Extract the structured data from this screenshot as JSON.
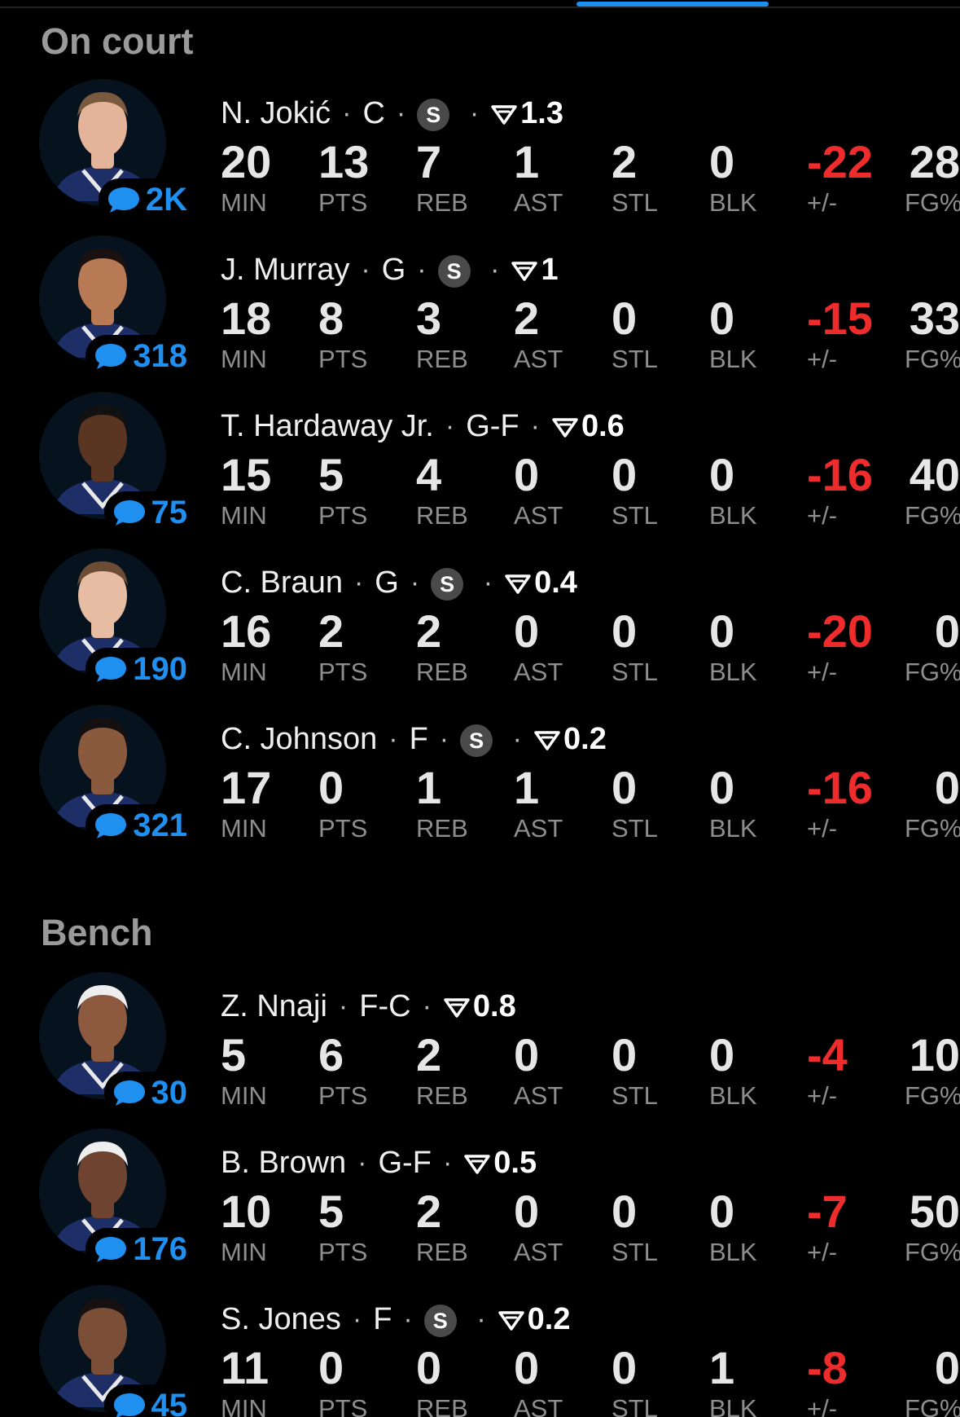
{
  "colors": {
    "accent": "#1f8ff0",
    "negative": "#ee2c2c",
    "muted_label": "#8e8e8e"
  },
  "sections": {
    "on_court": "On court",
    "bench": "Bench"
  },
  "labels": {
    "min": "MIN",
    "pts": "PTS",
    "reb": "REB",
    "ast": "AST",
    "stl": "STL",
    "blk": "BLK",
    "pm": "+/-",
    "fg": "FG%"
  },
  "icons": {
    "comment": "chat-bubble-icon",
    "rating": "rating-chevron-icon",
    "starter": "starter-badge-icon"
  },
  "players": [
    {
      "name": "N. Jokić",
      "pos": "C",
      "starter": "S",
      "rating": "1.3",
      "comments": "2K",
      "min": "20",
      "pts": "13",
      "reb": "7",
      "ast": "1",
      "stl": "2",
      "blk": "0",
      "pm": "-22",
      "fg": "28"
    },
    {
      "name": "J. Murray",
      "pos": "G",
      "starter": "S",
      "rating": "1",
      "comments": "318",
      "min": "18",
      "pts": "8",
      "reb": "3",
      "ast": "2",
      "stl": "0",
      "blk": "0",
      "pm": "-15",
      "fg": "33"
    },
    {
      "name": "T. Hardaway Jr.",
      "pos": "G-F",
      "starter": "",
      "rating": "0.6",
      "comments": "75",
      "min": "15",
      "pts": "5",
      "reb": "4",
      "ast": "0",
      "stl": "0",
      "blk": "0",
      "pm": "-16",
      "fg": "40"
    },
    {
      "name": "C. Braun",
      "pos": "G",
      "starter": "S",
      "rating": "0.4",
      "comments": "190",
      "min": "16",
      "pts": "2",
      "reb": "2",
      "ast": "0",
      "stl": "0",
      "blk": "0",
      "pm": "-20",
      "fg": "0"
    },
    {
      "name": "C. Johnson",
      "pos": "F",
      "starter": "S",
      "rating": "0.2",
      "comments": "321",
      "min": "17",
      "pts": "0",
      "reb": "1",
      "ast": "1",
      "stl": "0",
      "blk": "0",
      "pm": "-16",
      "fg": "0"
    },
    {
      "name": "Z. Nnaji",
      "pos": "F-C",
      "starter": "",
      "rating": "0.8",
      "comments": "30",
      "min": "5",
      "pts": "6",
      "reb": "2",
      "ast": "0",
      "stl": "0",
      "blk": "0",
      "pm": "-4",
      "fg": "10"
    },
    {
      "name": "B. Brown",
      "pos": "G-F",
      "starter": "",
      "rating": "0.5",
      "comments": "176",
      "min": "10",
      "pts": "5",
      "reb": "2",
      "ast": "0",
      "stl": "0",
      "blk": "0",
      "pm": "-7",
      "fg": "50"
    },
    {
      "name": "S. Jones",
      "pos": "F",
      "starter": "S",
      "rating": "0.2",
      "comments": "45",
      "min": "11",
      "pts": "0",
      "reb": "0",
      "ast": "0",
      "stl": "0",
      "blk": "1",
      "pm": "-8",
      "fg": "0"
    }
  ]
}
